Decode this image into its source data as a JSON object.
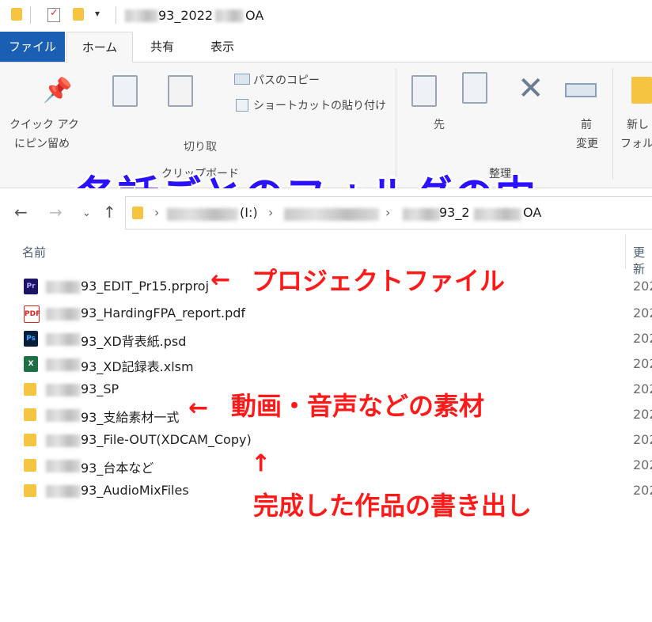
{
  "window": {
    "title_visible": "93_2022",
    "title_suffix": "OA"
  },
  "ribbon_tabs": {
    "file": "ファイル",
    "home": "ホーム",
    "share": "共有",
    "view": "表示"
  },
  "ribbon": {
    "pin_label_1": "クイック アク",
    "pin_label_2": "にピン留め",
    "copy_path": "パスのコピー",
    "paste_shortcut": "ショートカットの貼り付け",
    "paste_fragment": "切り取",
    "clipboard_group": "クリップボード",
    "move_fragment": "先",
    "rename_fragment_1": "前",
    "rename_fragment_2": "変更",
    "organize_group": "整理",
    "new_label_1": "新し",
    "new_label_2": "フォル"
  },
  "overlay_title": "各話ごとのフォルダの中",
  "address": {
    "drive": "(I:)",
    "folder_prefix": "93_2",
    "folder_suffix": "OA"
  },
  "columns": {
    "name": "名前",
    "modified": "更新"
  },
  "files": [
    {
      "name": "93_EDIT_Pr15.prproj",
      "icon": "premiere-icon",
      "date": "202"
    },
    {
      "name": "93_HardingFPA_report.pdf",
      "icon": "pdf-icon",
      "date": "202"
    },
    {
      "name": "93_XD背表紙.psd",
      "icon": "photoshop-icon",
      "date": "202"
    },
    {
      "name": "93_XD記録表.xlsm",
      "icon": "excel-icon",
      "date": "202"
    },
    {
      "name": "93_SP",
      "icon": "folder-icon",
      "date": "202"
    },
    {
      "name": "93_支給素材一式",
      "icon": "folder-icon",
      "date": "202"
    },
    {
      "name": "93_File-OUT(XDCAM_Copy)",
      "icon": "folder-icon",
      "date": "202"
    },
    {
      "name": "93_台本など",
      "icon": "folder-icon",
      "date": "202"
    },
    {
      "name": "93_AudioMixFiles",
      "icon": "folder-icon",
      "date": "202"
    }
  ],
  "annotations": {
    "project_file": "プロジェクトファイル",
    "materials": "動画・音声などの素材",
    "output": "完成した作品の書き出し"
  },
  "colors": {
    "annotation_red": "#ff1a1a",
    "title_blue": "#2a12ff",
    "file_tab_blue": "#1a5fb4"
  }
}
